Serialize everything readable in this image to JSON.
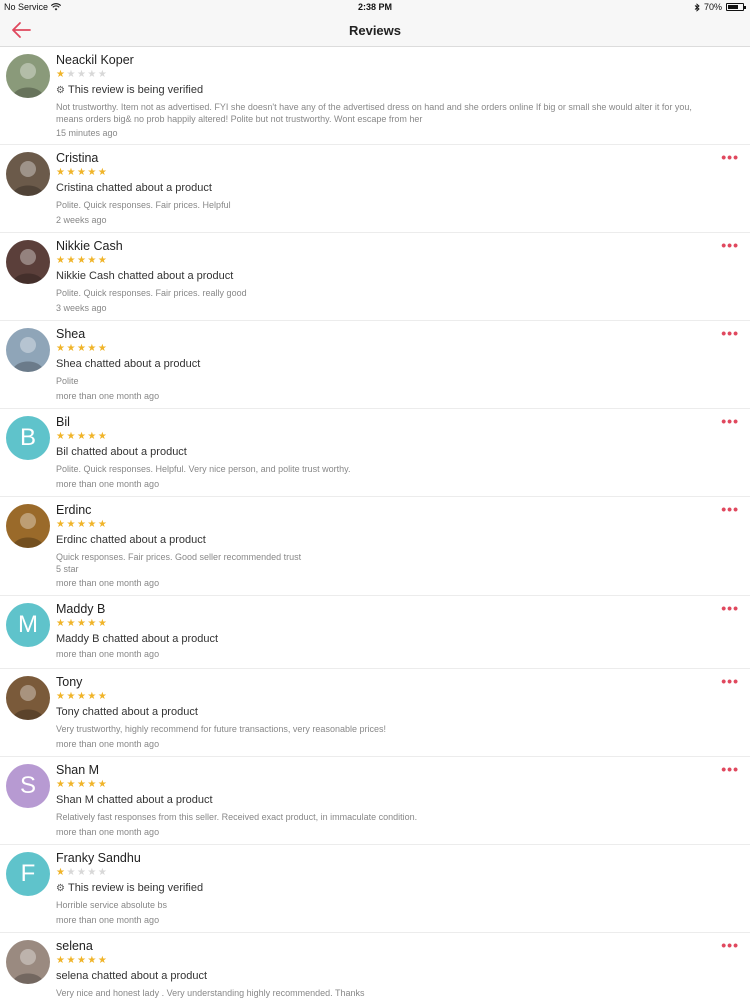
{
  "status_bar": {
    "carrier": "No Service",
    "time": "2:38 PM",
    "battery": "70%",
    "battery_level": 0.7
  },
  "nav": {
    "title": "Reviews",
    "back_icon": "back-arrow-icon"
  },
  "colors": {
    "accent": "#e0485e",
    "star": "#f0b429"
  },
  "reviews": [
    {
      "name": "Neackil Koper",
      "rating": 1,
      "subtitle": "This review is being verified",
      "verifying": true,
      "comment": "Not trustworthy. Item not as advertised. FYI she doesn't have any of the advertised dress on hand and she orders online If big or small she would alter it for you, means orders big& no prob happily altered! Polite but not trustworthy. Wont escape from her",
      "time": "15 minutes ago",
      "more": false,
      "avatar_color": "#8a9a7a"
    },
    {
      "name": "Cristina",
      "rating": 5,
      "subtitle": "Cristina chatted about a product",
      "comment": "Polite. Quick responses. Fair prices. Helpful",
      "time": "2 weeks ago",
      "more": true,
      "avatar_color": "#6b5a4a"
    },
    {
      "name": "Nikkie Cash",
      "rating": 5,
      "subtitle": "Nikkie Cash chatted about a product",
      "comment": "Polite. Quick responses. Fair prices. really good",
      "time": "3 weeks ago",
      "more": true,
      "avatar_color": "#5b3f3a"
    },
    {
      "name": "Shea",
      "rating": 5,
      "subtitle": "Shea chatted about a product",
      "comment": "Polite",
      "time": "more than one month ago",
      "more": true,
      "avatar_color": "#8fa5b8"
    },
    {
      "name": "Bil",
      "rating": 5,
      "subtitle": "Bil chatted about a product",
      "comment": "Polite. Quick responses. Helpful. Very nice person, and polite trust worthy.",
      "time": "more than one month ago",
      "more": true,
      "avatar_letter": "B",
      "avatar_color": "#5fc3cb"
    },
    {
      "name": "Erdinc",
      "rating": 5,
      "subtitle": "Erdinc chatted about a product",
      "comment": "Quick responses. Fair prices. Good seller recommended trust\n5 star",
      "time": "more than one month ago",
      "more": true,
      "avatar_color": "#9a6a2a"
    },
    {
      "name": "Maddy B",
      "rating": 5,
      "subtitle": "Maddy B chatted about a product",
      "comment": "",
      "time": "more than one month ago",
      "more": true,
      "avatar_letter": "M",
      "avatar_color": "#5fc3cb"
    },
    {
      "name": "Tony",
      "rating": 5,
      "subtitle": "Tony chatted about a product",
      "comment": "Very trustworthy, highly recommend for future transactions, very reasonable prices!",
      "time": "more than one month ago",
      "more": true,
      "avatar_color": "#7a5a3a"
    },
    {
      "name": "Shan M",
      "rating": 5,
      "subtitle": "Shan M chatted about a product",
      "comment": "Relatively fast responses from this seller. Received exact product, in immaculate condition.",
      "time": "more than one month ago",
      "more": true,
      "avatar_letter": "S",
      "avatar_color": "#b79ad2"
    },
    {
      "name": "Franky Sandhu",
      "rating": 1,
      "subtitle": "This review is being verified",
      "verifying": true,
      "comment": "Horrible service absolute  bs",
      "time": "more than one month ago",
      "more": false,
      "avatar_letter": "F",
      "avatar_color": "#5fc3cb"
    },
    {
      "name": "selena",
      "rating": 5,
      "subtitle": "selena chatted about a product",
      "comment": "Very nice and honest lady . Very understanding highly recommended. Thanks",
      "time": "",
      "more": true,
      "avatar_color": "#9a8a80"
    }
  ]
}
